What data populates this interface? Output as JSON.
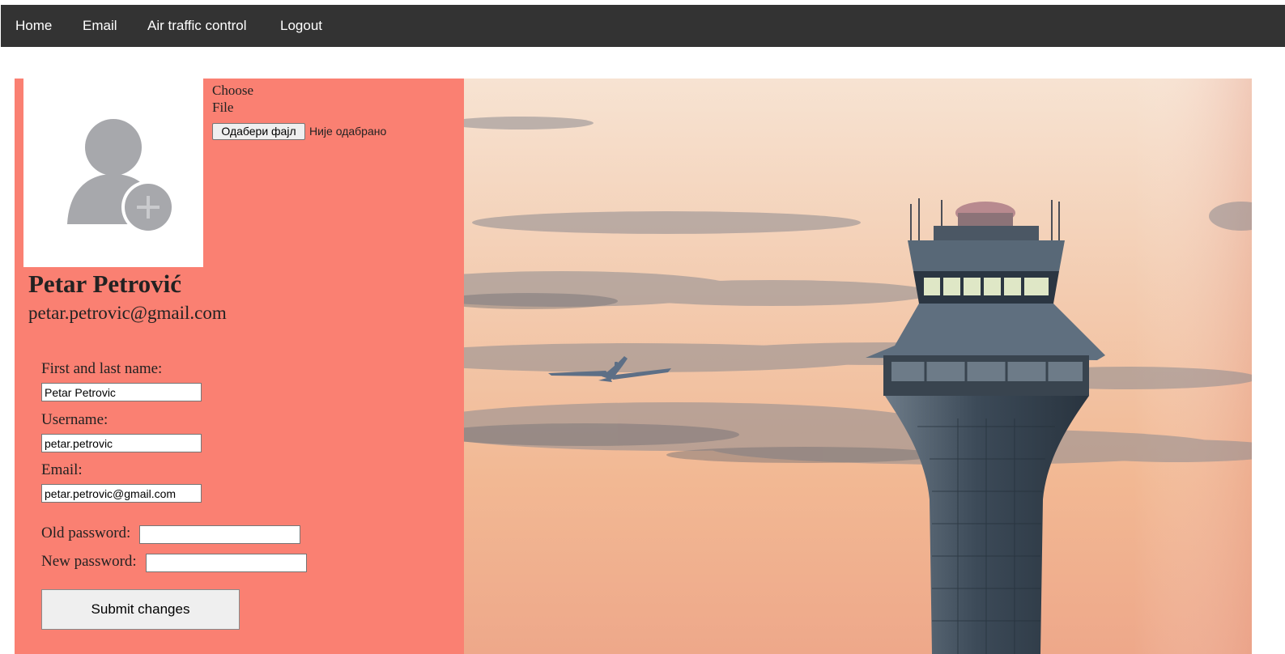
{
  "nav": {
    "items": [
      {
        "label": "Home"
      },
      {
        "label": "Email"
      },
      {
        "label": "Air traffic control"
      },
      {
        "label": "Logout"
      }
    ]
  },
  "profile": {
    "avatar_icon": "user-add-icon",
    "file_picker": {
      "label": "Choose File",
      "button_label": "Одабери фајл",
      "status": "Није одабрано"
    },
    "display_name": "Petar Petrović",
    "display_email": "petar.petrovic@gmail.com"
  },
  "form": {
    "name_label": "First and last name:",
    "name_value": "Petar Petrovic",
    "username_label": "Username:",
    "username_value": "petar.petrovic",
    "email_label": "Email:",
    "email_value": "petar.petrovic@gmail.com",
    "old_password_label": "Old password:",
    "old_password_value": "",
    "new_password_label": "New password:",
    "new_password_value": "",
    "submit_label": "Submit changes"
  },
  "hero": {
    "description_icon": "control-tower-photo"
  },
  "colors": {
    "navbar": "#333333",
    "panel": "#fa8072",
    "nav_text": "#ffffff"
  }
}
